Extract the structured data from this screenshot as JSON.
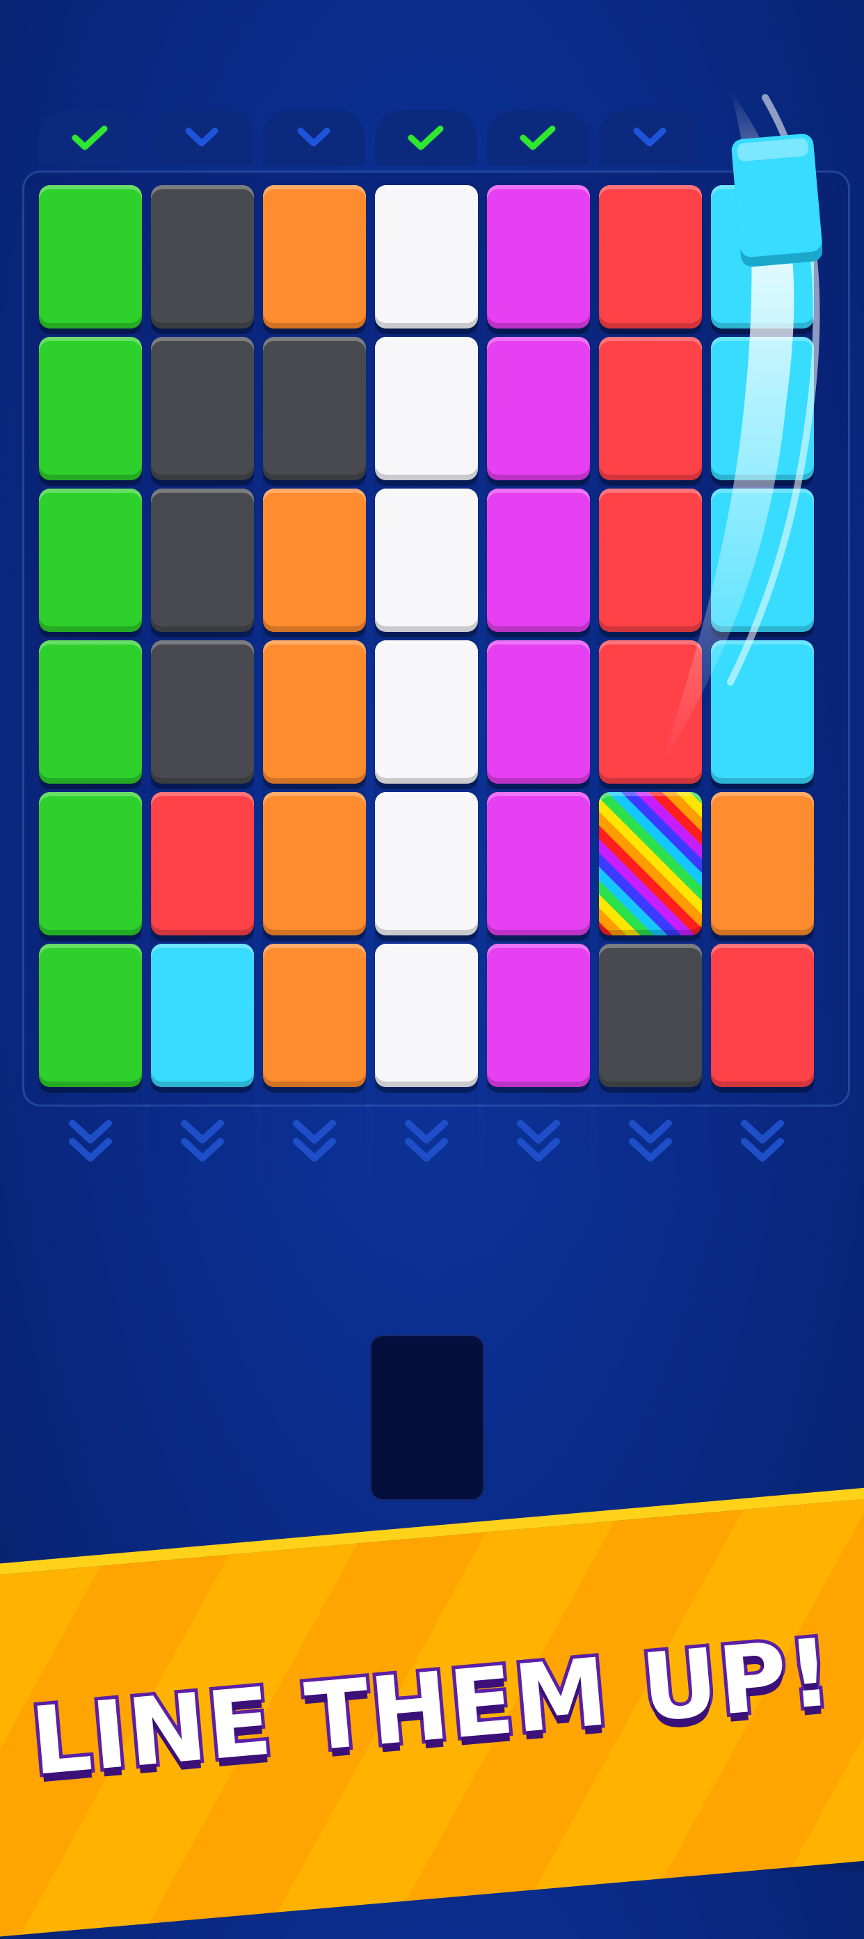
{
  "banner": {
    "text": "LINE THEM UP!"
  },
  "colors": {
    "green": "#2ed12b",
    "dark": "#494a4f",
    "orange": "#ff8c2e",
    "white": "#f7f7f9",
    "magenta": "#e73ff2",
    "red": "#ff4148",
    "cyan": "#37dcff"
  },
  "columns": [
    {
      "status": "completed",
      "icon": "check-icon"
    },
    {
      "status": "pending",
      "icon": "chevron-down-icon"
    },
    {
      "status": "pending",
      "icon": "chevron-down-icon"
    },
    {
      "status": "completed",
      "icon": "check-icon"
    },
    {
      "status": "completed",
      "icon": "check-icon"
    },
    {
      "status": "pending",
      "icon": "chevron-down-icon"
    },
    {
      "status": "pending",
      "icon": "none"
    }
  ],
  "grid": [
    [
      "green",
      "dark",
      "orange",
      "white",
      "magenta",
      "red",
      "cyan"
    ],
    [
      "green",
      "dark",
      "dark",
      "white",
      "magenta",
      "red",
      "cyan"
    ],
    [
      "green",
      "dark",
      "orange",
      "white",
      "magenta",
      "red",
      "cyan"
    ],
    [
      "green",
      "dark",
      "orange",
      "white",
      "magenta",
      "red",
      "cyan"
    ],
    [
      "green",
      "red",
      "orange",
      "white",
      "magenta",
      "rainbow",
      "orange"
    ],
    [
      "green",
      "cyan",
      "orange",
      "white",
      "magenta",
      "dark",
      "red"
    ]
  ],
  "moving_tile": {
    "color": "cyan"
  },
  "drop_slot": {
    "state": "empty"
  }
}
